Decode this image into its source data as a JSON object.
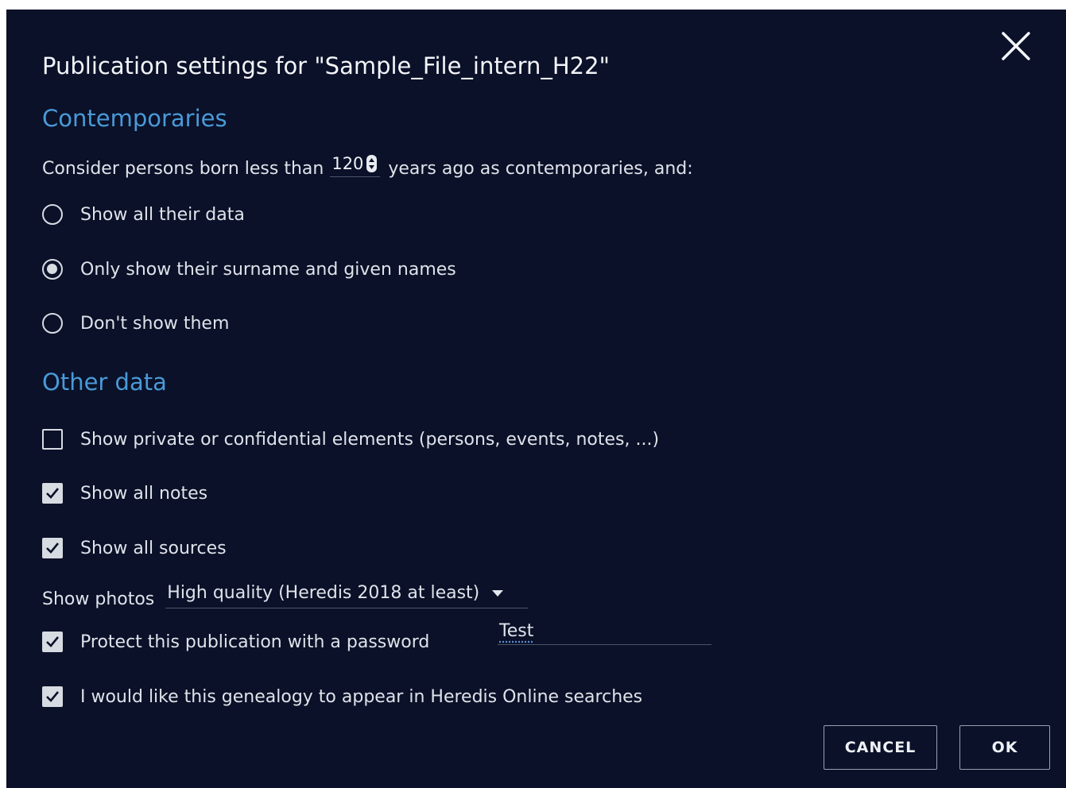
{
  "dialog": {
    "title": "Publication settings for \"Sample_File_intern_H22\"",
    "close_icon": "close-icon"
  },
  "contemporaries": {
    "heading": "Contemporaries",
    "prefix": "Consider persons born less than",
    "years_value": "120",
    "suffix": "years ago as contemporaries, and:",
    "options": [
      {
        "label": "Show all their data",
        "selected": false
      },
      {
        "label": "Only show their surname and given names",
        "selected": true
      },
      {
        "label": "Don't show them",
        "selected": false
      }
    ]
  },
  "other_data": {
    "heading": "Other data",
    "show_private": {
      "label": "Show private or confidential elements (persons, events, notes, ...)",
      "checked": false
    },
    "show_notes": {
      "label": "Show all notes",
      "checked": true
    },
    "show_sources": {
      "label": "Show all sources",
      "checked": true
    },
    "photos": {
      "label": "Show photos",
      "selected": "High quality (Heredis 2018 at least)"
    },
    "password": {
      "label": "Protect this publication with a password",
      "checked": true,
      "value": "Test"
    },
    "searches": {
      "label": "I would like this genealogy to appear in Heredis Online searches",
      "checked": true
    }
  },
  "buttons": {
    "cancel": "CANCEL",
    "ok": "OK"
  },
  "colors": {
    "background": "#0a1128",
    "accent": "#4a9ad8",
    "text": "#dfe3ea"
  }
}
